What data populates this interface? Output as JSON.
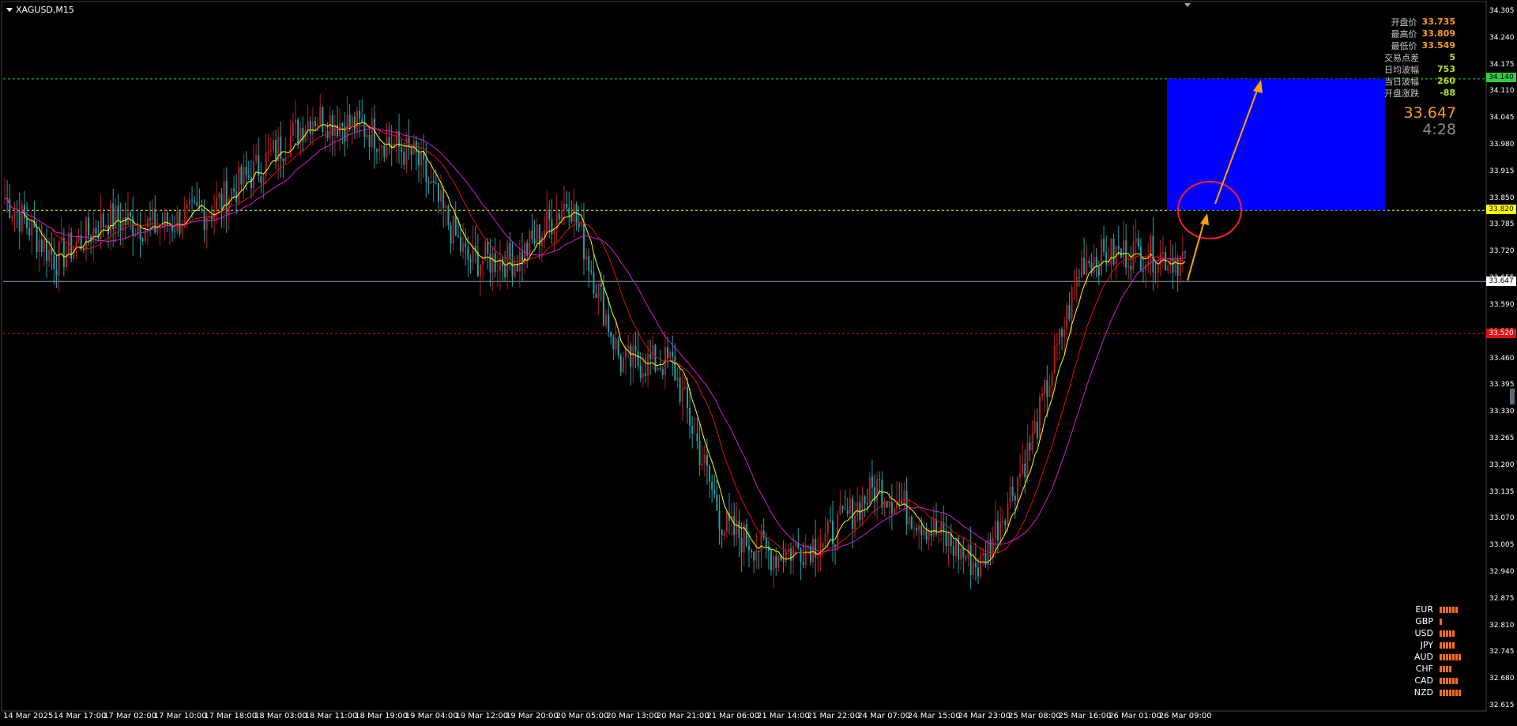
{
  "window": {
    "title": "XAGUSD,M15"
  },
  "price_axis": {
    "ticks": [
      "34.305",
      "34.240",
      "34.175",
      "34.110",
      "34.045",
      "33.980",
      "33.915",
      "33.850",
      "33.785",
      "33.720",
      "33.655",
      "33.590",
      "33.525",
      "33.460",
      "33.395",
      "33.330",
      "33.265",
      "33.200",
      "33.135",
      "33.070",
      "33.005",
      "32.940",
      "32.875",
      "32.810",
      "32.745",
      "32.680",
      "32.615"
    ],
    "tags": {
      "green_level": "34.140",
      "yellow_level": "33.820",
      "current": "33.647",
      "red_level": "33.520"
    }
  },
  "time_axis": {
    "labels": [
      "14 Mar 2025",
      "14 Mar 17:00",
      "17 Mar 02:00",
      "17 Mar 10:00",
      "17 Mar 18:00",
      "18 Mar 03:00",
      "18 Mar 11:00",
      "18 Mar 19:00",
      "19 Mar 04:00",
      "19 Mar 12:00",
      "19 Mar 20:00",
      "20 Mar 05:00",
      "20 Mar 13:00",
      "20 Mar 21:00",
      "21 Mar 06:00",
      "21 Mar 14:00",
      "21 Mar 22:00",
      "24 Mar 07:00",
      "24 Mar 15:00",
      "24 Mar 23:00",
      "25 Mar 08:00",
      "25 Mar 16:00",
      "26 Mar 01:00",
      "26 Mar 09:00"
    ]
  },
  "info_panel": [
    {
      "label": "开盘价",
      "value": "33.735",
      "color": "#ff9a1f"
    },
    {
      "label": "最高价",
      "value": "33.809",
      "color": "#ff9a1f"
    },
    {
      "label": "最低价",
      "value": "33.549",
      "color": "#ff9a1f"
    },
    {
      "label": "交易点差",
      "value": "5",
      "color": "#b5e61d"
    },
    {
      "label": "日均波幅",
      "value": "753",
      "color": "#b5e61d"
    },
    {
      "label": "当日波幅",
      "value": "260",
      "color": "#b5e61d"
    },
    {
      "label": "开盘涨跌",
      "value": "-88",
      "color": "#b5e61d"
    }
  ],
  "big_price": "33.647",
  "bar_timer": "4:28",
  "currency_strength": [
    {
      "name": "EUR",
      "bars": 6
    },
    {
      "name": "GBP",
      "bars": 1
    },
    {
      "name": "USD",
      "bars": 5
    },
    {
      "name": "JPY",
      "bars": 5
    },
    {
      "name": "AUD",
      "bars": 7
    },
    {
      "name": "CHF",
      "bars": 4
    },
    {
      "name": "CAD",
      "bars": 6
    },
    {
      "name": "NZD",
      "bars": 7
    }
  ],
  "colors": {
    "bull_candle": "#b22222",
    "bear_candle": "#1fa0a8",
    "ma_fast": "#ffff00",
    "ma_mid": "#e01010",
    "ma_slow": "#d020d0",
    "target_box": "#0000ff",
    "arrow": "#ffa500",
    "circle": "#ff2020"
  },
  "chart_data": {
    "type": "line",
    "symbol": "XAGUSD",
    "timeframe": "M15",
    "ylim": [
      32.615,
      34.305
    ],
    "levels": {
      "resistance_green": 34.14,
      "breakout_yellow": 33.82,
      "current": 33.647,
      "support_red": 33.52
    },
    "target_zone": {
      "from": 33.82,
      "to": 34.14
    },
    "x": [
      "14 Mar 2025",
      "14 Mar 17:00",
      "17 Mar 02:00",
      "17 Mar 10:00",
      "17 Mar 18:00",
      "18 Mar 03:00",
      "18 Mar 11:00",
      "18 Mar 19:00",
      "19 Mar 04:00",
      "19 Mar 12:00",
      "19 Mar 20:00",
      "20 Mar 05:00",
      "20 Mar 13:00",
      "20 Mar 21:00",
      "21 Mar 06:00",
      "21 Mar 14:00",
      "21 Mar 22:00",
      "24 Mar 07:00",
      "24 Mar 15:00",
      "24 Mar 23:00",
      "25 Mar 08:00",
      "25 Mar 16:00",
      "26 Mar 01:00",
      "26 Mar 09:00"
    ],
    "series": [
      {
        "values": [
          33.85,
          33.7,
          33.8,
          33.78,
          33.82,
          33.93,
          34.05,
          34.02,
          33.95,
          33.7,
          33.7,
          33.85,
          33.45,
          33.45,
          33.05,
          32.98,
          33.02,
          33.15,
          33.05,
          32.95,
          33.25,
          33.7,
          33.72,
          33.7
        ]
      }
    ]
  }
}
